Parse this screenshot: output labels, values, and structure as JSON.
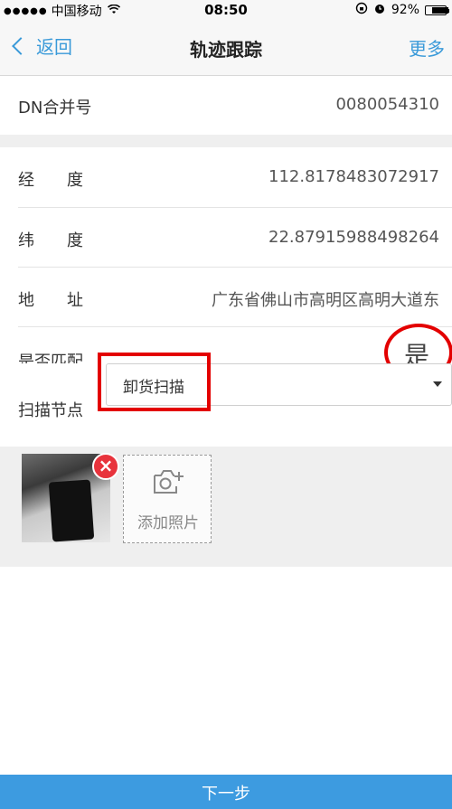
{
  "status_bar": {
    "signal_dots": "●●●●●",
    "carrier": "中国移动",
    "time": "08:50",
    "battery_percent": "92%",
    "battery_level": 0.92
  },
  "nav": {
    "back_label": "返回",
    "title": "轨迹跟踪",
    "more_label": "更多"
  },
  "form": {
    "dn_label": "DN合并号",
    "dn_value": "0080054310",
    "longitude_label": "经　　度",
    "longitude_value": "112.8178483072917",
    "latitude_label": "纬　　度",
    "latitude_value": "22.87915988498264",
    "address_label": "地　　址",
    "address_value": "广东省佛山市高明区高明大道东",
    "match_label": "是否匹配",
    "match_value": "是",
    "scan_node_label": "扫描节点",
    "scan_node_value": "卸货扫描"
  },
  "photos": {
    "delete_symbol": "×",
    "add_label": "添加照片"
  },
  "footer": {
    "next_label": "下一步"
  },
  "colors": {
    "accent": "#3a9ad9",
    "highlight": "#e30000",
    "delete": "#e8333c"
  }
}
